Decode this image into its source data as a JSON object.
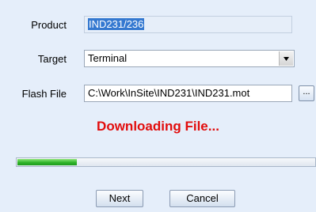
{
  "form": {
    "product": {
      "label": "Product",
      "value": "IND231/236"
    },
    "target": {
      "label": "Target",
      "value": "Terminal",
      "dropdown_icon": "chevron-down-icon"
    },
    "flash_file": {
      "label": "Flash File",
      "value": "C:\\Work\\InSite\\IND231\\IND231.mot",
      "browse_label": "..."
    }
  },
  "status": {
    "text": "Downloading File...",
    "color": "#e20d0d",
    "progress_fraction": 0.2
  },
  "buttons": {
    "next_label": "Next",
    "cancel_label": "Cancel"
  },
  "colors": {
    "panel_background": "#e5eefa",
    "progress_fill": "#2fb52a",
    "selection": "#3478d0"
  }
}
